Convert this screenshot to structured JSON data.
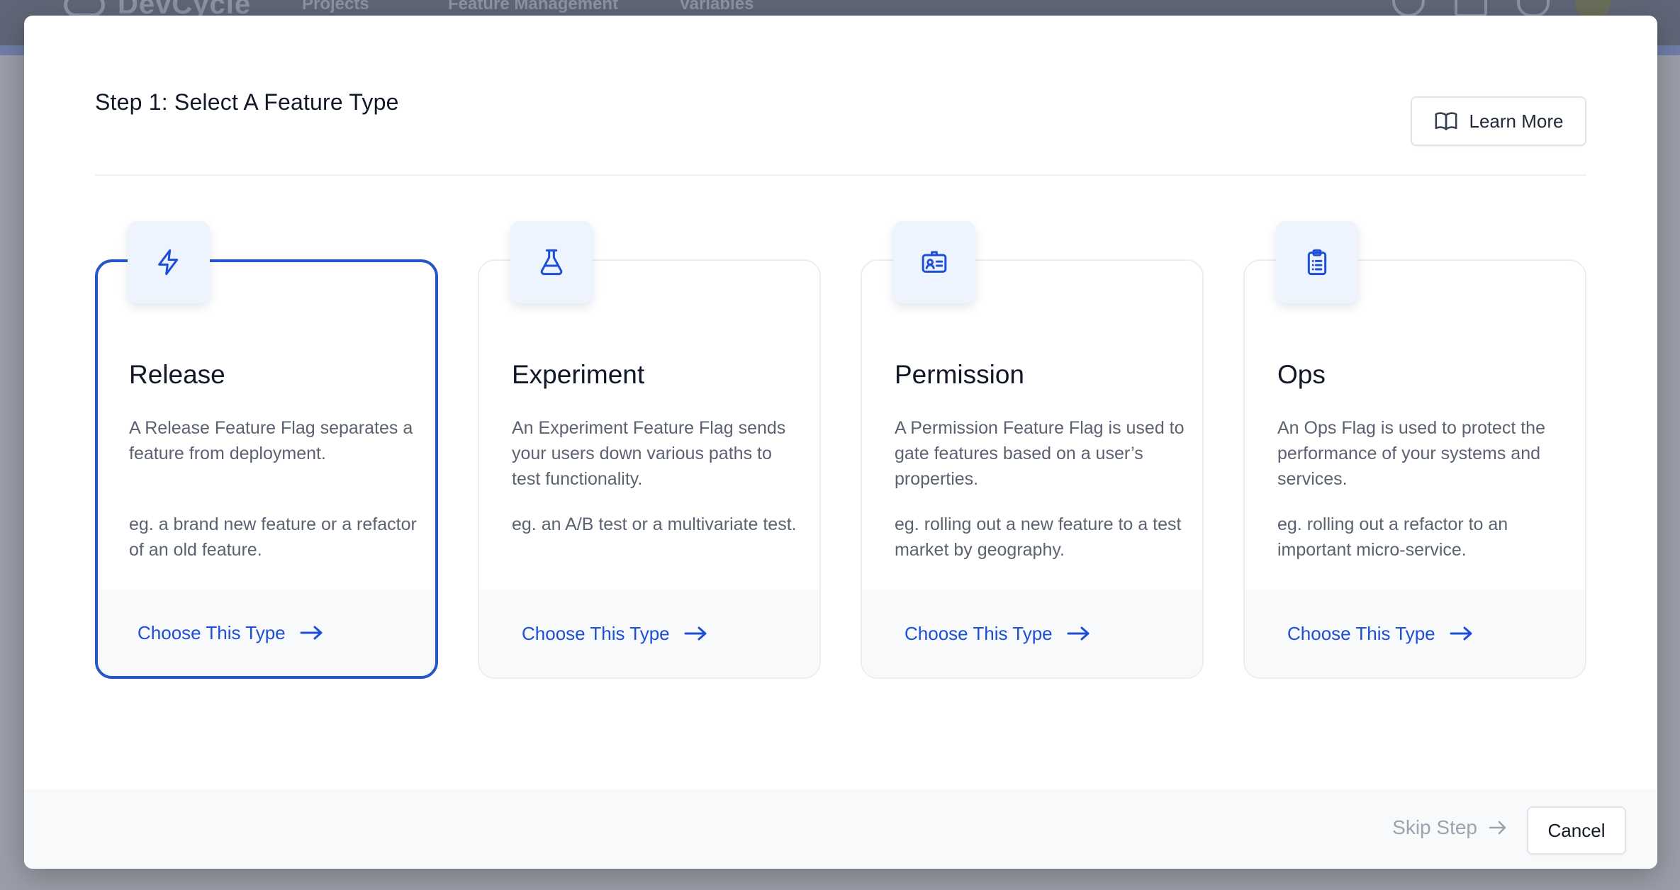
{
  "background": {
    "logo_text": "DevCycle",
    "nav": [
      "Projects",
      "Feature Management",
      "Variables"
    ]
  },
  "modal": {
    "title": "Step 1: Select A Feature Type",
    "learn_more_label": "Learn More",
    "accent_color": "#2357c9"
  },
  "cards": [
    {
      "title": "Release",
      "icon": "lightning-icon",
      "description": "A Release Feature Flag separates a feature from deployment.",
      "example": "eg. a brand new feature or a refactor of an old feature.",
      "cta": "Choose This Type",
      "selected": true
    },
    {
      "title": "Experiment",
      "icon": "beaker-icon",
      "description": "An Experiment Feature Flag sends your users down various paths to test functionality.",
      "example": "eg. an A/B test or a multivariate test.",
      "cta": "Choose This Type",
      "selected": false
    },
    {
      "title": "Permission",
      "icon": "id-badge-icon",
      "description": "A Permission Feature Flag is used to gate features based on a user’s properties.",
      "example": "eg. rolling out a new feature to a test market by geography.",
      "cta": "Choose This Type",
      "selected": false
    },
    {
      "title": "Ops",
      "icon": "clipboard-list-icon",
      "description": "An Ops Flag is used to protect the performance of your systems and services.",
      "example": "eg. rolling out a refactor to an important micro-service.",
      "cta": "Choose This Type",
      "selected": false
    }
  ],
  "footer": {
    "skip_label": "Skip Step",
    "cancel_label": "Cancel"
  }
}
